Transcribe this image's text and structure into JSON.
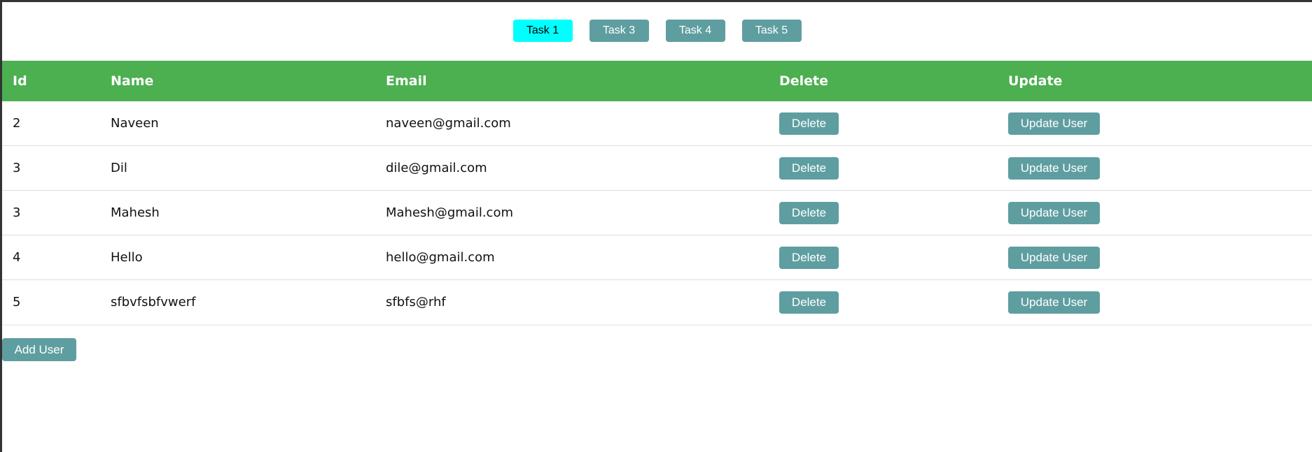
{
  "nav": {
    "tabs": [
      {
        "label": "Task 1",
        "active": true
      },
      {
        "label": "Task 3",
        "active": false
      },
      {
        "label": "Task 4",
        "active": false
      },
      {
        "label": "Task 5",
        "active": false
      }
    ]
  },
  "table": {
    "headers": {
      "id": "Id",
      "name": "Name",
      "email": "Email",
      "delete": "Delete",
      "update": "Update"
    },
    "delete_label": "Delete",
    "update_label": "Update User",
    "rows": [
      {
        "id": "2",
        "name": "Naveen",
        "email": "naveen@gmail.com"
      },
      {
        "id": "3",
        "name": "Dil",
        "email": "dile@gmail.com"
      },
      {
        "id": "3",
        "name": "Mahesh",
        "email": "Mahesh@gmail.com"
      },
      {
        "id": "4",
        "name": "Hello",
        "email": "hello@gmail.com"
      },
      {
        "id": "5",
        "name": "sfbvfsbfvwerf",
        "email": "sfbfs@rhf"
      }
    ]
  },
  "add_user_label": "Add User",
  "colors": {
    "header_green": "#4caf50",
    "button_teal": "#5f9ea0",
    "active_tab_cyan": "#00ffff"
  }
}
